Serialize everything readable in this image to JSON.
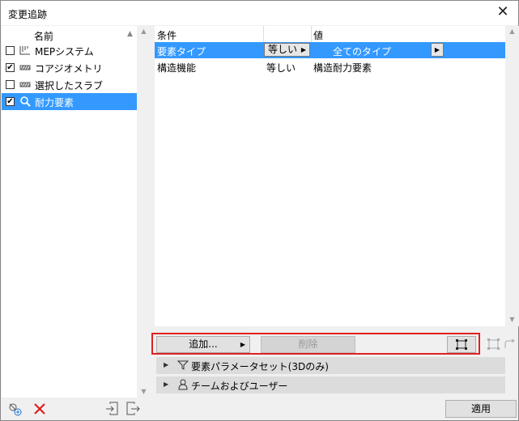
{
  "window": {
    "title": "変更追跡",
    "close_glyph": "✕"
  },
  "left_panel": {
    "header": "名前",
    "items": [
      {
        "label": "MEPシステム",
        "checked": false,
        "icon": "mep-icon",
        "selected": false
      },
      {
        "label": "コアジオメトリ",
        "checked": true,
        "icon": "hatch-icon",
        "selected": false
      },
      {
        "label": "選択したスラブ",
        "checked": false,
        "icon": "hatch-icon",
        "selected": false
      },
      {
        "label": "耐力要素",
        "checked": true,
        "icon": "magnify-icon",
        "selected": true
      }
    ]
  },
  "criteria": {
    "columns": [
      "条件",
      "",
      "値"
    ],
    "rows": [
      {
        "condition": "要素タイプ",
        "operator": "等しい",
        "value": "全てのタイプ",
        "selected": true
      },
      {
        "condition": "構造機能",
        "operator": "等しい",
        "value": "構造耐力要素",
        "selected": false
      }
    ]
  },
  "buttons": {
    "add": "追加...",
    "delete": "削除"
  },
  "expanders": {
    "param_set": "要素パラメータセット(3Dのみ)",
    "team": "チームおよびユーザー"
  },
  "footer": {
    "apply": "適用"
  },
  "colors": {
    "selection": "#3399ff",
    "highlight_border": "#e02020",
    "delete_icon": "#e02020"
  }
}
